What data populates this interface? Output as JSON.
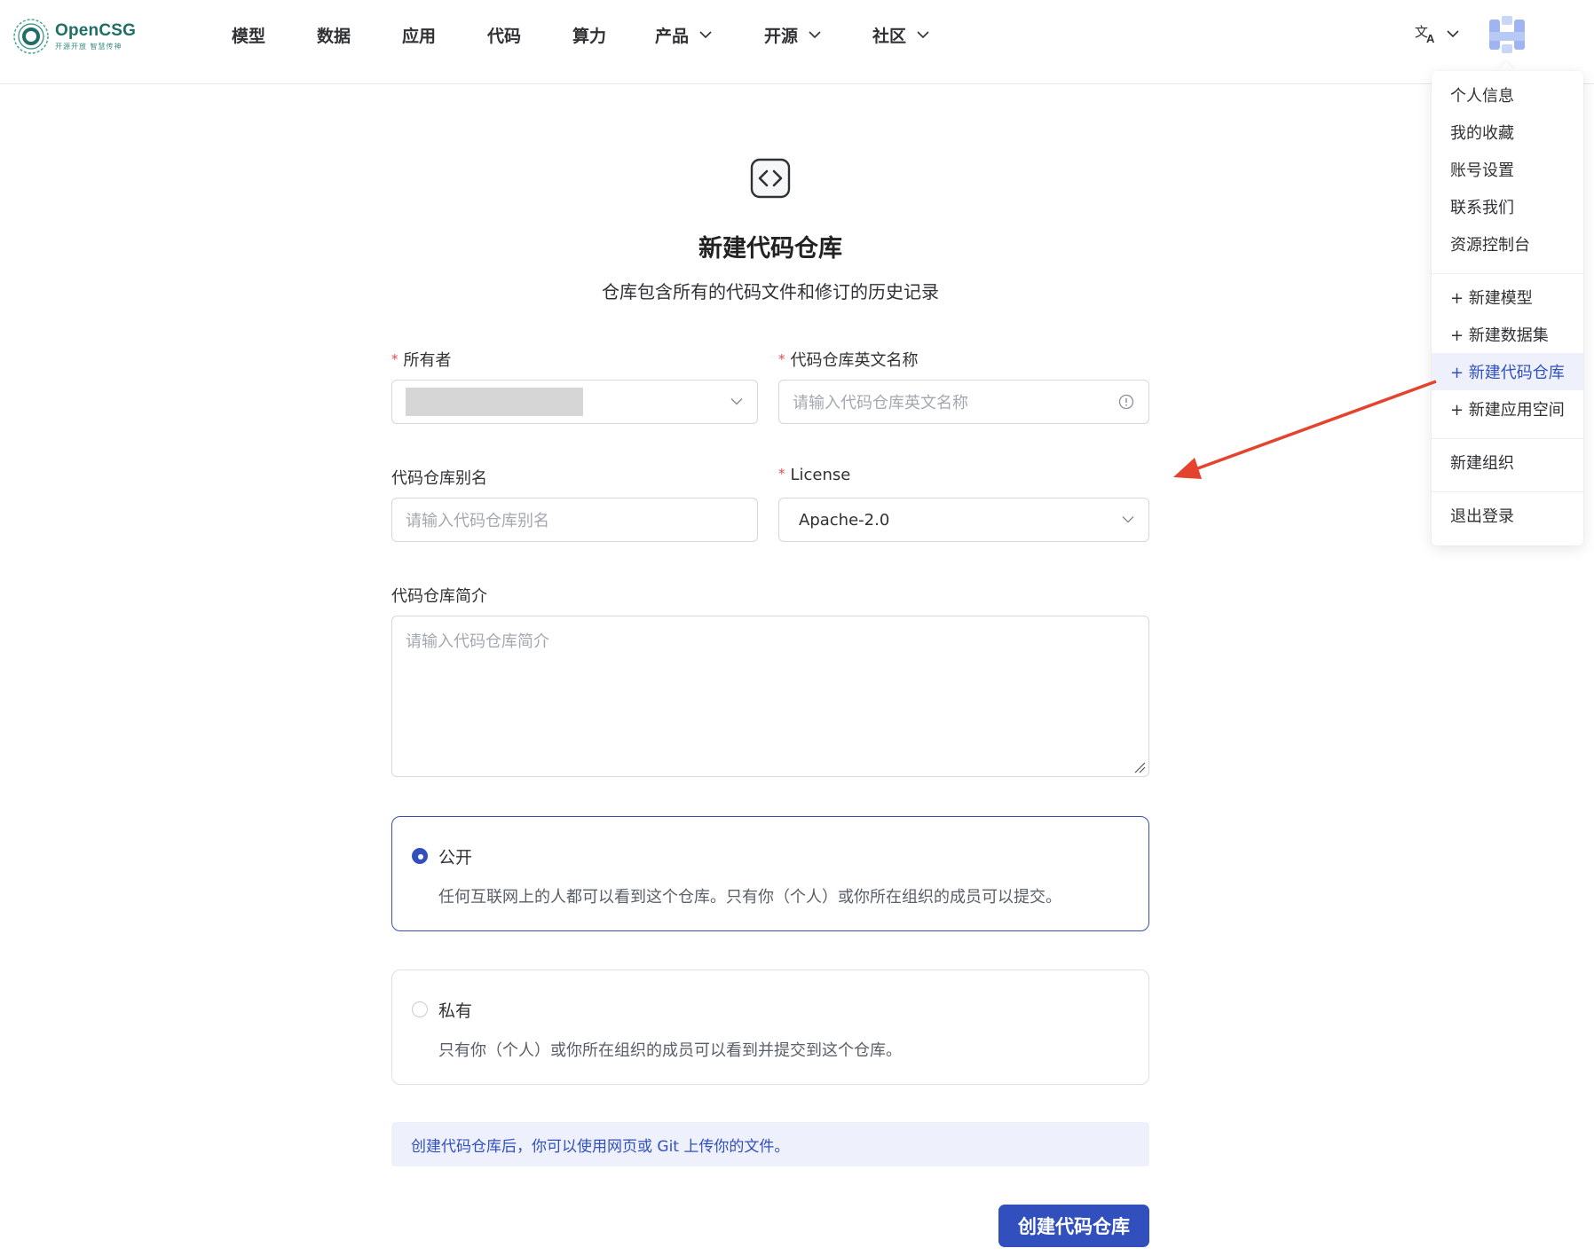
{
  "header": {
    "logo": {
      "name": "OpenCSG",
      "slogan": "开源开放  智慧传神"
    },
    "nav": [
      {
        "label": "模型",
        "has_dropdown": false
      },
      {
        "label": "数据",
        "has_dropdown": false
      },
      {
        "label": "应用",
        "has_dropdown": false
      },
      {
        "label": "代码",
        "has_dropdown": false
      },
      {
        "label": "算力",
        "has_dropdown": false
      },
      {
        "label": "产品",
        "has_dropdown": true
      },
      {
        "label": "开源",
        "has_dropdown": true
      },
      {
        "label": "社区",
        "has_dropdown": true
      }
    ],
    "language_icon": "translate-icon",
    "avatar_icon": "user-avatar"
  },
  "user_menu": {
    "items": [
      {
        "label": "个人信息"
      },
      {
        "label": "我的收藏"
      },
      {
        "label": "账号设置"
      },
      {
        "label": "联系我们"
      },
      {
        "label": "资源控制台"
      },
      {
        "label": "+ 新建模型"
      },
      {
        "label": "+ 新建数据集"
      },
      {
        "label": "+ 新建代码仓库",
        "active": true
      },
      {
        "label": "+ 新建应用空间"
      },
      {
        "label": "新建组织"
      },
      {
        "label": "退出登录"
      }
    ]
  },
  "form": {
    "icon": "code-brackets-icon",
    "title": "新建代码仓库",
    "subtitle": "仓库包含所有的代码文件和修订的历史记录",
    "owner": {
      "label": "所有者",
      "required": true,
      "value": ""
    },
    "name": {
      "label": "代码仓库英文名称",
      "required": true,
      "placeholder": "请输入代码仓库英文名称"
    },
    "alias": {
      "label": "代码仓库别名",
      "required": false,
      "placeholder": "请输入代码仓库别名"
    },
    "license": {
      "label": "License",
      "required": true,
      "value": "Apache-2.0"
    },
    "description": {
      "label": "代码仓库简介",
      "placeholder": "请输入代码仓库简介"
    },
    "visibility": [
      {
        "title": "公开",
        "desc": "任何互联网上的人都可以看到这个仓库。只有你（个人）或你所在组织的成员可以提交。",
        "selected": true
      },
      {
        "title": "私有",
        "desc": "只有你（个人）或你所在组织的成员可以看到并提交到这个仓库。",
        "selected": false
      }
    ],
    "notice": "创建代码仓库后，你可以使用网页或 Git 上传你的文件。",
    "submit_label": "创建代码仓库"
  },
  "colors": {
    "brand_primary": "#3250bd",
    "logo_green": "#1f6f67",
    "annotation_arrow": "#e4432d",
    "required_mark": "#e5484d"
  }
}
